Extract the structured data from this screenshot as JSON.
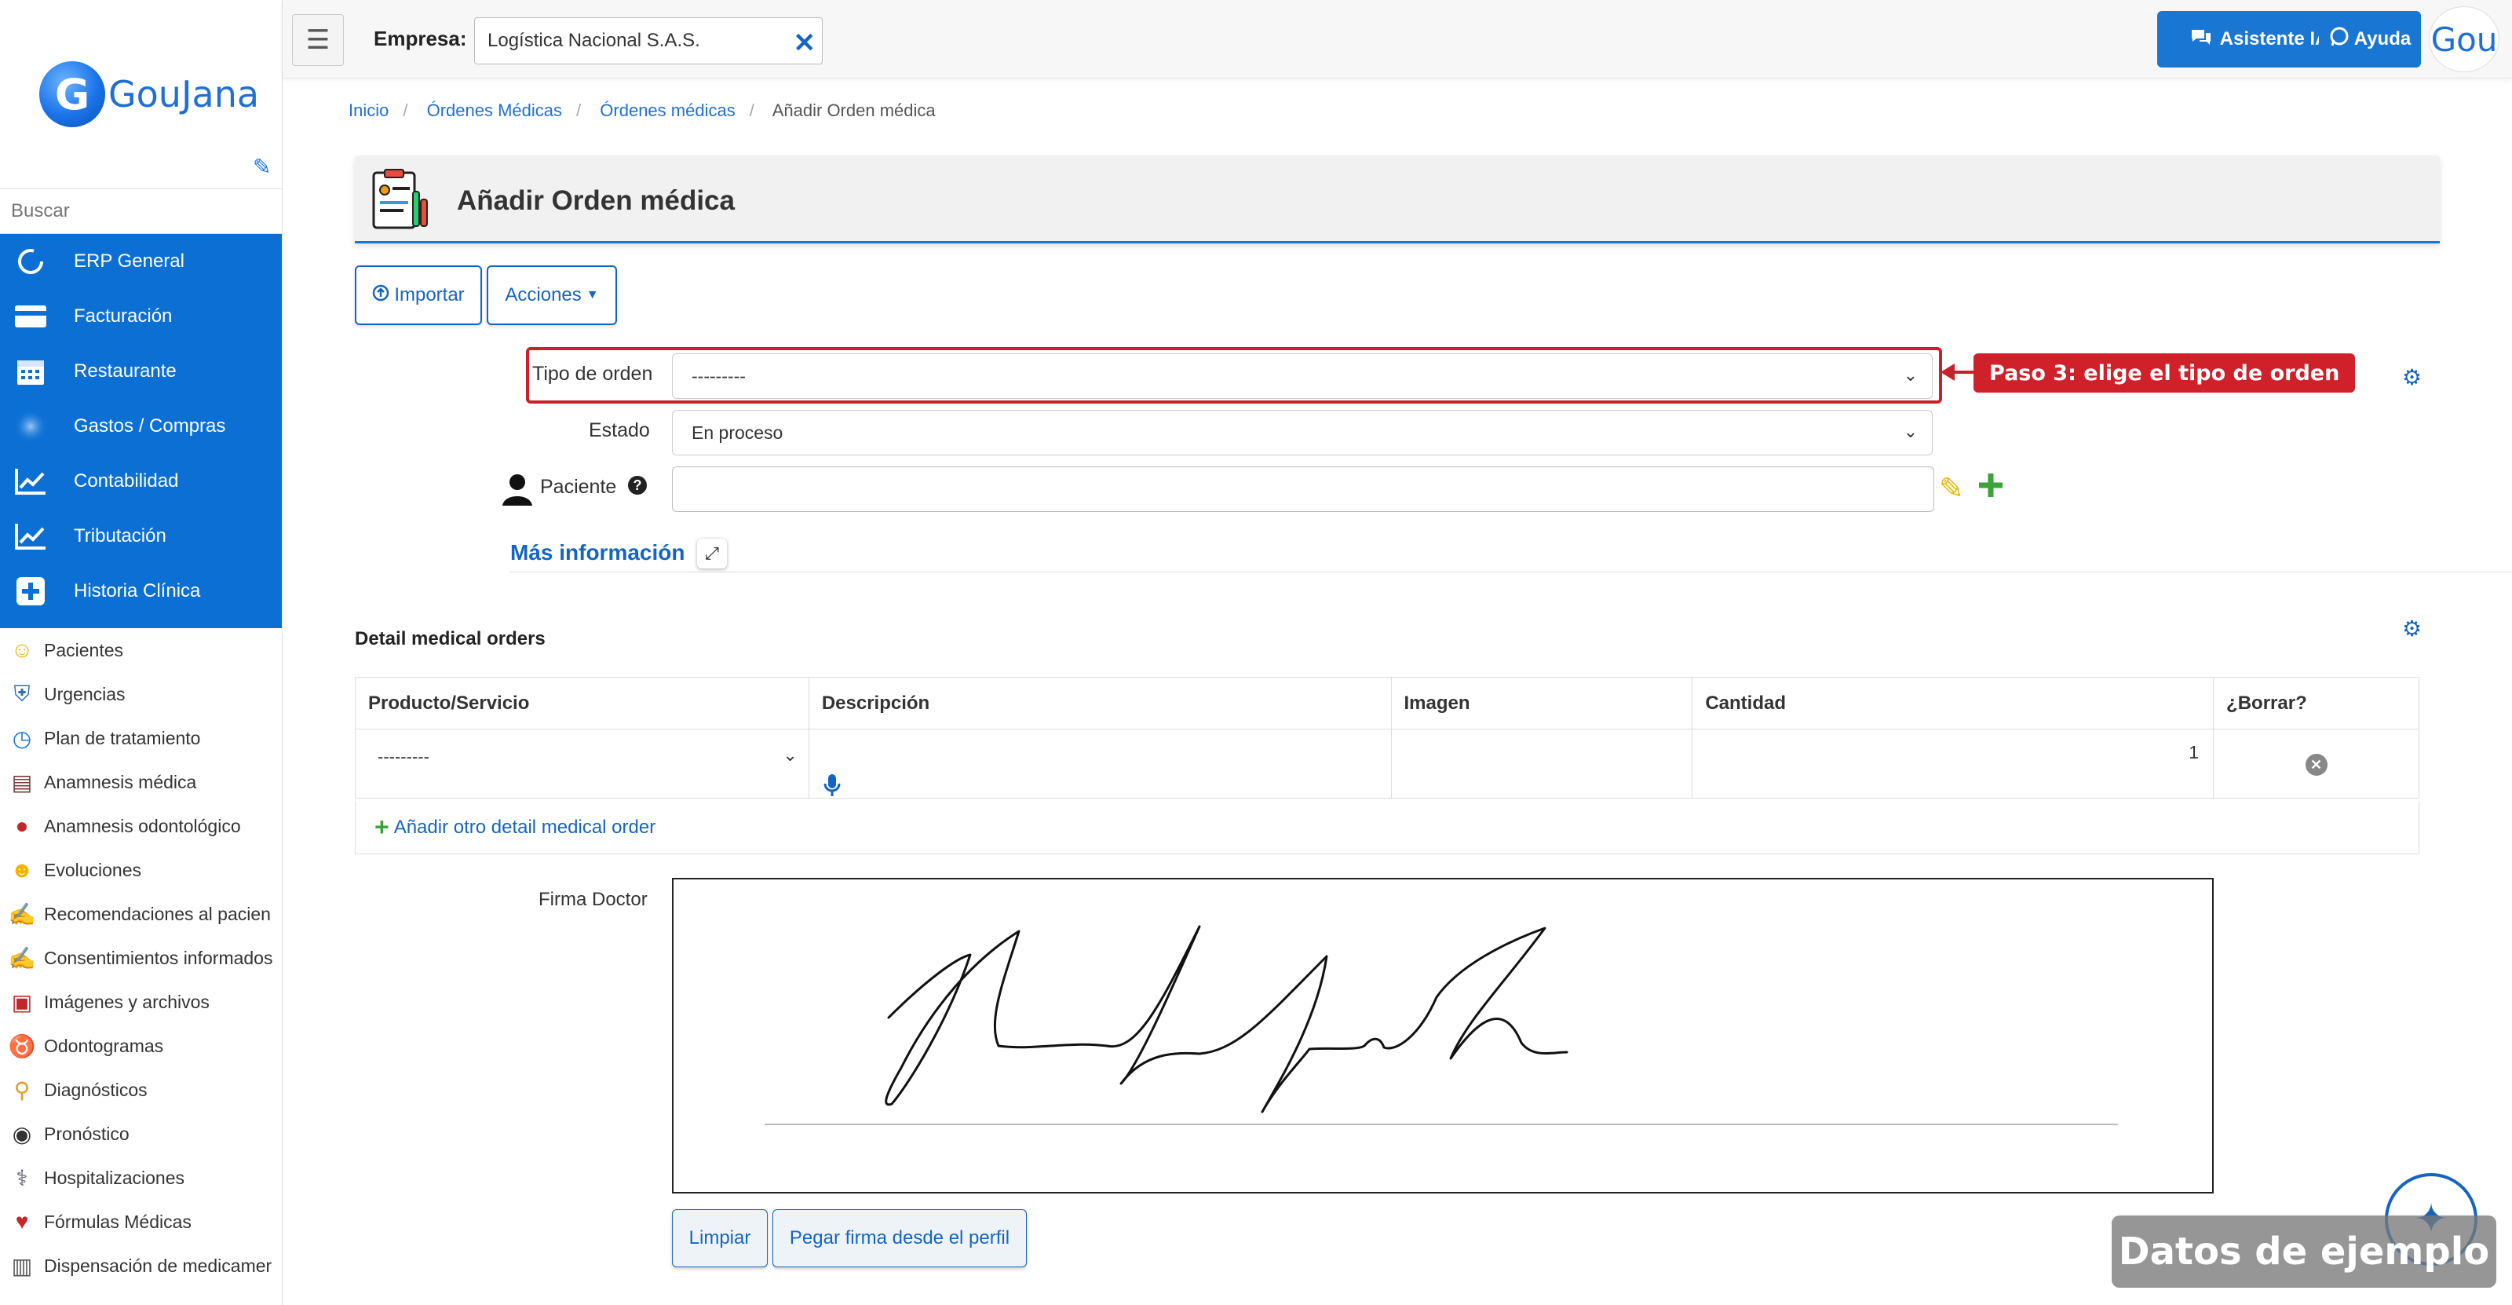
{
  "sidebar": {
    "logo_letter": "G",
    "logo_text": "GouJana",
    "search_placeholder": "Buscar",
    "modules": [
      {
        "label": "ERP General",
        "icon": "circle-arrow-icon"
      },
      {
        "label": "Facturación",
        "icon": "credit-card-icon"
      },
      {
        "label": "Restaurante",
        "icon": "calendar-icon"
      },
      {
        "label": "Gastos / Compras",
        "icon": "blur-circle-icon"
      },
      {
        "label": "Contabilidad",
        "icon": "chart-line-icon"
      },
      {
        "label": "Tributación",
        "icon": "chart-line-icon"
      },
      {
        "label": "Historia Clínica",
        "icon": "medical-plus-icon"
      }
    ],
    "items": [
      {
        "label": "Pacientes",
        "icon": "smiley-icon"
      },
      {
        "label": "Urgencias",
        "icon": "ambulance-icon"
      },
      {
        "label": "Plan de tratamiento",
        "icon": "clock-plus-icon"
      },
      {
        "label": "Anamnesis médica",
        "icon": "clipboard-icon"
      },
      {
        "label": "Anamnesis odontológico",
        "icon": "mouth-icon"
      },
      {
        "label": "Evoluciones",
        "icon": "thinking-face-icon"
      },
      {
        "label": "Recomendaciones al pacien",
        "icon": "signature-icon"
      },
      {
        "label": "Consentimientos informados",
        "icon": "signature-icon"
      },
      {
        "label": "Imágenes y archivos",
        "icon": "camera-icon"
      },
      {
        "label": "Odontogramas",
        "icon": "tooth-icon"
      },
      {
        "label": "Diagnósticos",
        "icon": "magnifier-icon"
      },
      {
        "label": "Pronóstico",
        "icon": "fortune-teller-icon"
      },
      {
        "label": "Hospitalizaciones",
        "icon": "hospital-bed-icon"
      },
      {
        "label": "Fórmulas Médicas",
        "icon": "heart-plus-icon"
      },
      {
        "label": "Dispensación de medicamer",
        "icon": "pharmacy-icon"
      }
    ]
  },
  "topbar": {
    "empresa_label": "Empresa:",
    "empresa_value": "Logística Nacional S.A.S.",
    "ai_label": "Asistente IA",
    "help_label": "Ayuda",
    "avatar_text": "Gou"
  },
  "breadcrumb": [
    "Inicio",
    "Órdenes Médicas",
    "Órdenes médicas",
    "Añadir Orden médica"
  ],
  "page": {
    "title": "Añadir Orden médica"
  },
  "actions": {
    "import_label": "Importar",
    "actions_label": "Acciones"
  },
  "form": {
    "tipo_label": "Tipo de orden",
    "tipo_value": "---------",
    "estado_label": "Estado",
    "estado_value": "En proceso",
    "paciente_label": "Paciente",
    "paciente_value": "",
    "more_info": "Más información"
  },
  "callout": {
    "text": "Paso 3: elige el tipo de orden",
    "color": "#d0202a"
  },
  "detail": {
    "title": "Detail medical orders",
    "headers": [
      "Producto/Servicio",
      "Descripción",
      "Imagen",
      "Cantidad",
      "¿Borrar?"
    ],
    "row": {
      "producto": "---------",
      "cantidad": "1"
    },
    "add_label": "Añadir otro detail medical order"
  },
  "signature": {
    "label": "Firma Doctor",
    "clear_label": "Limpiar",
    "paste_label": "Pegar firma desde el perfil"
  },
  "watermark": "Datos de ejemplo",
  "colors": {
    "primary": "#1976d2",
    "sidebar_blue": "#0b6fd4",
    "highlight_red": "#c9202b"
  }
}
